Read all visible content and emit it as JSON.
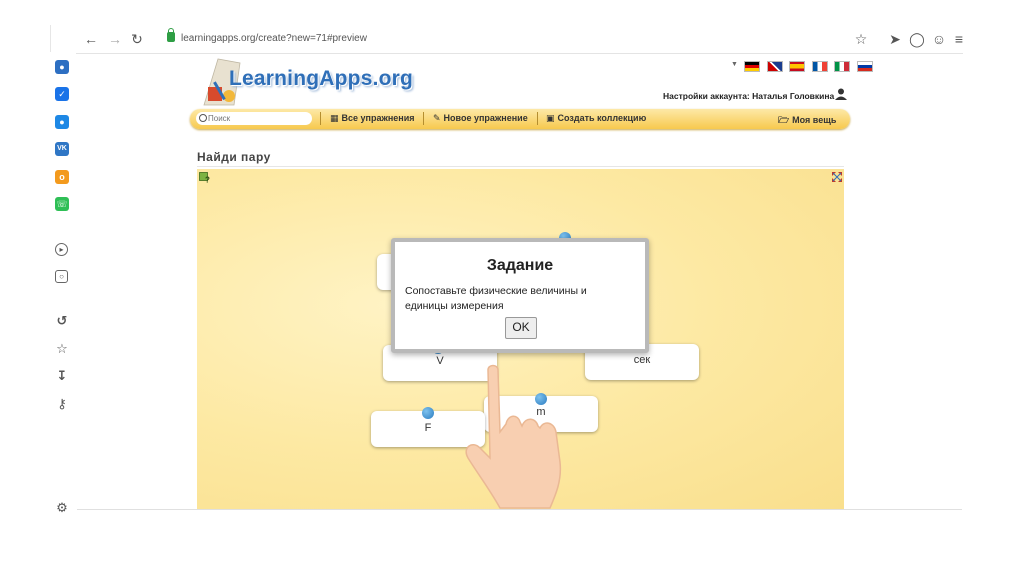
{
  "browser": {
    "url": "learningapps.org/create?new=71#preview"
  },
  "site": {
    "logo": "LearningApps.org",
    "account_label": "Настройки аккаунта: Наталья Головкина",
    "search_placeholder": "Поиск",
    "nav": {
      "all_exercises": "Все упражнения",
      "new_exercise": "Новое упражнение",
      "create_collection": "Создать коллекцию",
      "my_stuff": "Моя вещь"
    }
  },
  "app": {
    "title": "Найди пару",
    "cards": {
      "v": "V",
      "sec": "сек",
      "m": "m",
      "f": "F"
    },
    "modal": {
      "title": "Задание",
      "text": "Сопоставьте физические величины и единицы измерения",
      "ok": "OK"
    }
  },
  "colors": {
    "logo_blue": "#2f6fb8",
    "navbar_yellow": "#f7c94e",
    "app_background": "#fde9a3",
    "dot_blue": "#2a7bc0"
  }
}
